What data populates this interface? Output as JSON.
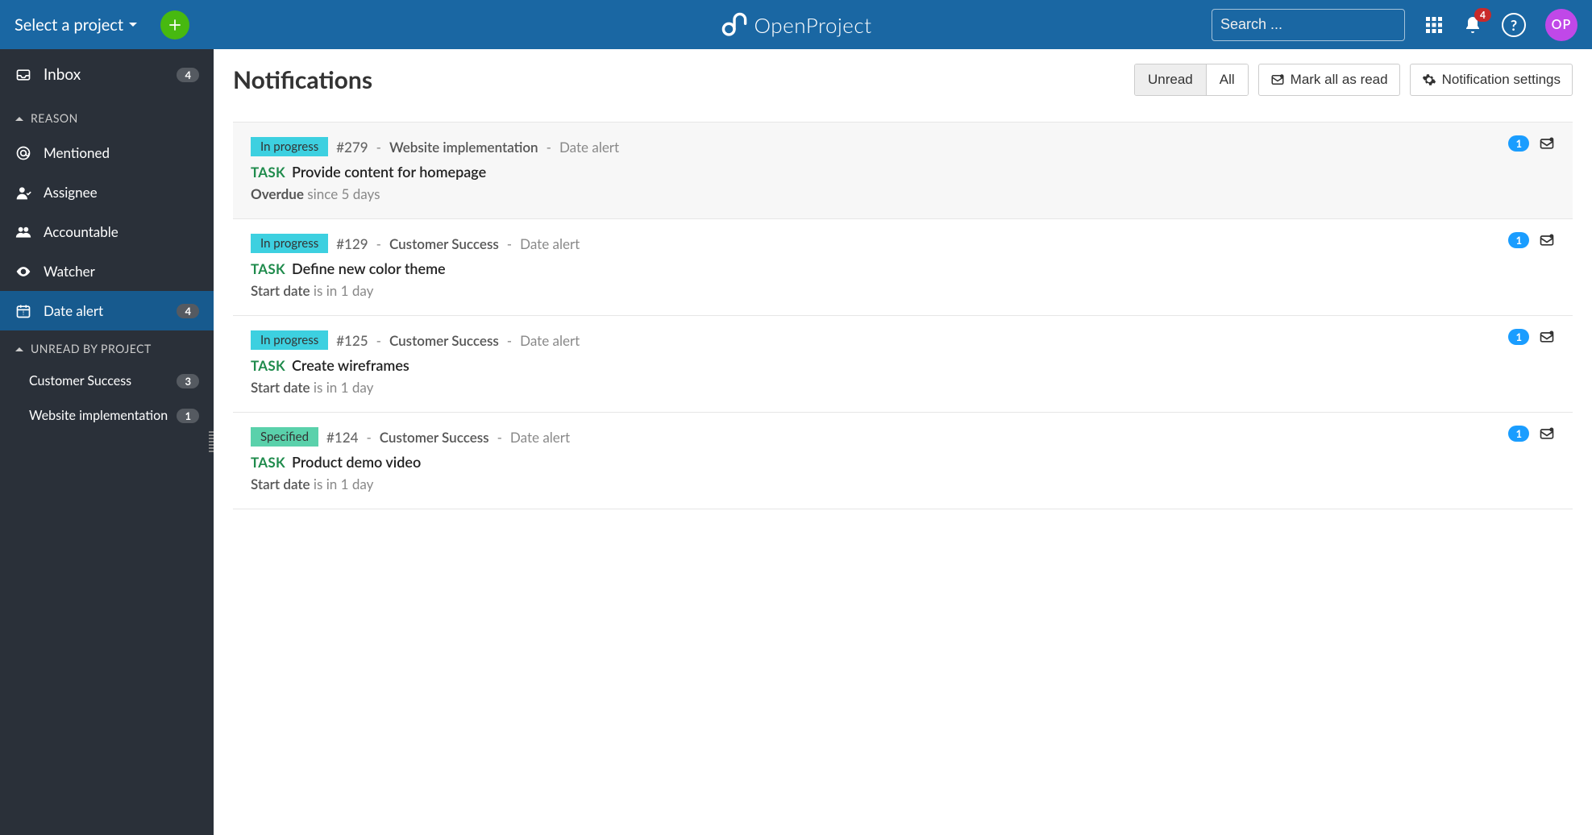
{
  "header": {
    "project_select_label": "Select a project",
    "brand": "OpenProject",
    "search_placeholder": "Search ...",
    "notification_count": "4",
    "avatar_initials": "OP"
  },
  "sidebar": {
    "inbox": {
      "label": "Inbox",
      "count": "4"
    },
    "section_reason": "REASON",
    "items": [
      {
        "label": "Mentioned"
      },
      {
        "label": "Assignee"
      },
      {
        "label": "Accountable"
      },
      {
        "label": "Watcher"
      },
      {
        "label": "Date alert",
        "count": "4",
        "active": true
      }
    ],
    "section_projects": "UNREAD BY PROJECT",
    "projects": [
      {
        "label": "Customer Success",
        "count": "3"
      },
      {
        "label": "Website implementation",
        "count": "1"
      }
    ]
  },
  "main": {
    "title": "Notifications",
    "filter_unread": "Unread",
    "filter_all": "All",
    "mark_all": "Mark all as read",
    "settings": "Notification settings"
  },
  "notifications": [
    {
      "status": "In progress",
      "status_class": "in-progress",
      "id": "#279",
      "project": "Website implementation",
      "reason": "Date alert",
      "type": "TASK",
      "title": "Provide content for homepage",
      "detail_label": "Overdue",
      "detail_value": "since 5 days",
      "overdue": true,
      "count": "1",
      "first": true
    },
    {
      "status": "In progress",
      "status_class": "in-progress",
      "id": "#129",
      "project": "Customer Success",
      "reason": "Date alert",
      "type": "TASK",
      "title": "Define new color theme",
      "detail_label": "Start date",
      "detail_value": "is in 1 day",
      "overdue": false,
      "count": "1"
    },
    {
      "status": "In progress",
      "status_class": "in-progress",
      "id": "#125",
      "project": "Customer Success",
      "reason": "Date alert",
      "type": "TASK",
      "title": "Create wireframes",
      "detail_label": "Start date",
      "detail_value": "is in 1 day",
      "overdue": false,
      "count": "1"
    },
    {
      "status": "Specified",
      "status_class": "specified",
      "id": "#124",
      "project": "Customer Success",
      "reason": "Date alert",
      "type": "TASK",
      "title": "Product demo video",
      "detail_label": "Start date",
      "detail_value": "is in 1 day",
      "overdue": false,
      "count": "1"
    }
  ]
}
